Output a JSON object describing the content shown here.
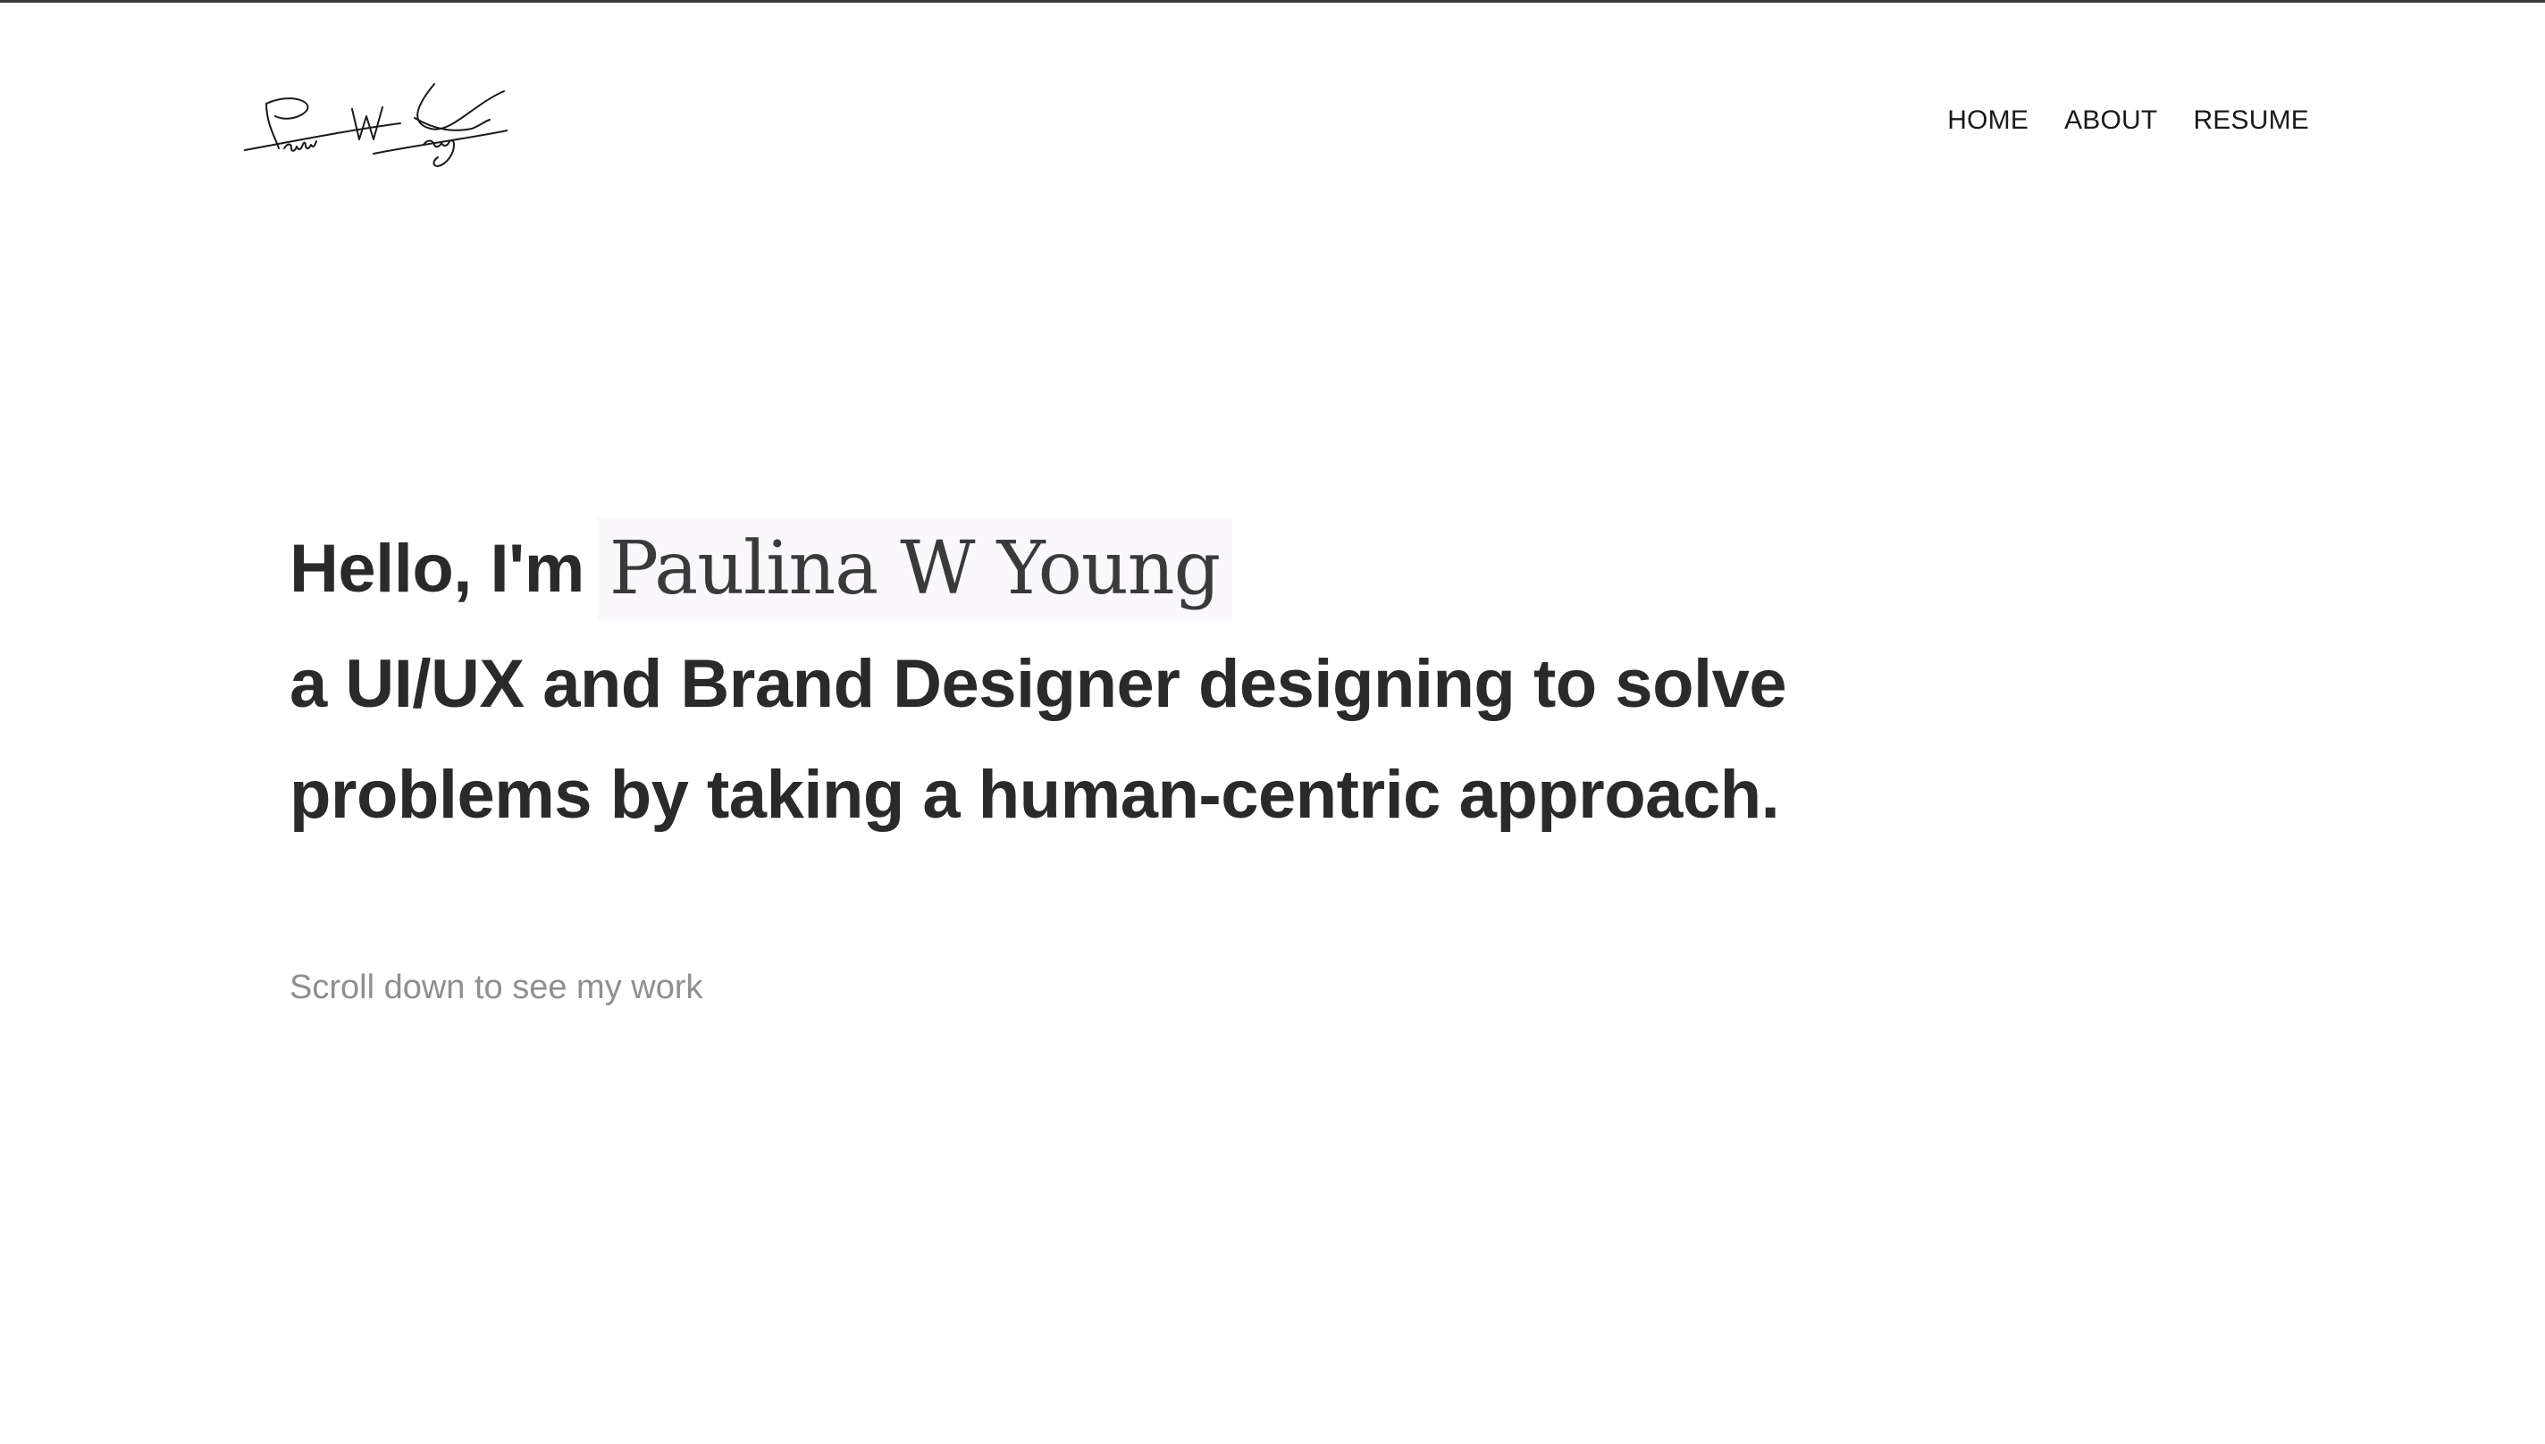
{
  "brand": {
    "logo_name": "signature-logo",
    "logo_signature": "Paulina W Young"
  },
  "nav": {
    "items": [
      {
        "label": "HOME"
      },
      {
        "label": "ABOUT"
      },
      {
        "label": "RESUME"
      }
    ]
  },
  "hero": {
    "greeting": "Hello, I'm",
    "name": "Paulina W Young",
    "line2": "a UI/UX and Brand Designer designing to solve",
    "line3": "problems by taking a human-centric approach."
  },
  "scroll_hint": "Scroll down to see my work",
  "colors": {
    "text": "#2a2a2a",
    "muted": "#8f8f8f",
    "name_highlight": "#fbf8fd",
    "background": "#ffffff"
  }
}
